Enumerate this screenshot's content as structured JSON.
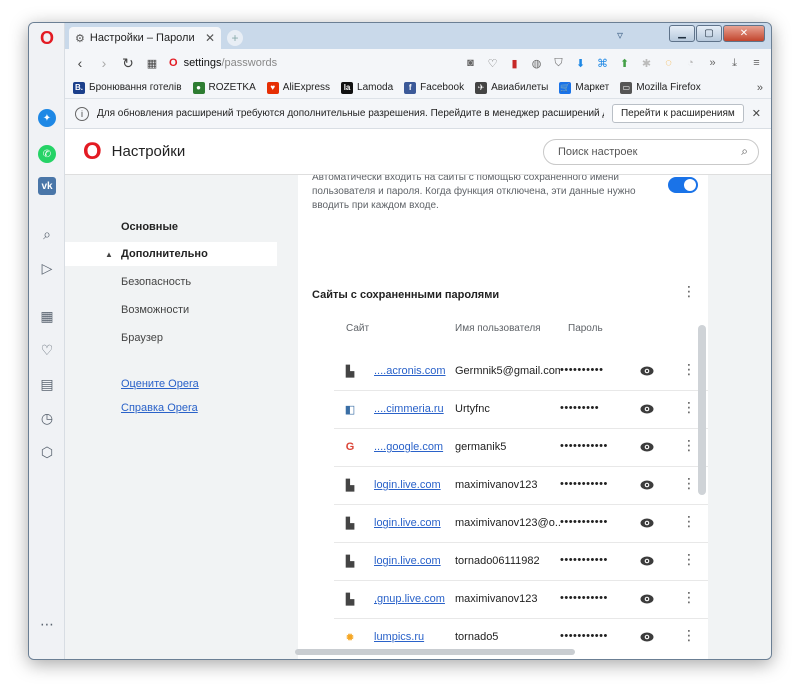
{
  "tab": {
    "title": "Настройки – Пароли"
  },
  "address": {
    "host": "settings",
    "path": "/passwords"
  },
  "bookmarks": [
    {
      "label": "Бронювання готелів",
      "icon": "booking-icon",
      "color": "#1b3f8b",
      "glyph": "B."
    },
    {
      "label": "ROZETKA",
      "icon": "rozetka-icon",
      "color": "#2e7d32",
      "glyph": "●"
    },
    {
      "label": "AliExpress",
      "icon": "aliexpress-icon",
      "color": "#e62e04",
      "glyph": "♥"
    },
    {
      "label": "Lamoda",
      "icon": "lamoda-icon",
      "color": "#111111",
      "glyph": "la"
    },
    {
      "label": "Facebook",
      "icon": "facebook-icon",
      "color": "#3b5998",
      "glyph": "f"
    },
    {
      "label": "Авиабилеты",
      "icon": "plane-icon",
      "color": "#444444",
      "glyph": "✈"
    },
    {
      "label": "Маркет",
      "icon": "cart-icon",
      "color": "#1a73e8",
      "glyph": "🛒"
    },
    {
      "label": "Mozilla Firefox",
      "icon": "folder-icon",
      "color": "#555555",
      "glyph": "▭"
    }
  ],
  "notification": {
    "text": "Для обновления расширений требуются дополнительные разрешения. Перейдите в менеджер расширений дл...",
    "button": "Перейти к расширениям"
  },
  "header": {
    "title": "Настройки",
    "search_placeholder": "Поиск настроек"
  },
  "nav": {
    "basic": "Основные",
    "advanced": "Дополнительно",
    "security": "Безопасность",
    "features": "Возможности",
    "browser": "Браузер",
    "rate": "Оцените Opera",
    "help": "Справка Opera"
  },
  "passwords": {
    "autologin_text": "Автоматически входить на сайты с помощью сохраненного имени пользователя и пароля. Когда функция отключена, эти данные нужно вводить при каждом входе.",
    "autologin_enabled": true,
    "section_title": "Сайты с сохраненными паролями",
    "columns": {
      "site": "Сайт",
      "user": "Имя пользователя",
      "password": "Пароль"
    },
    "rows": [
      {
        "site": "....acronis.com",
        "user": "Germnik5@gmail.com",
        "password": "••••••••••",
        "icon": "file-icon"
      },
      {
        "site": "....cimmeria.ru",
        "user": "Urtyfnc",
        "password": "•••••••••",
        "icon": "cimmeria-icon"
      },
      {
        "site": "....google.com",
        "user": "germanik5",
        "password": "•••••••••••",
        "icon": "google-icon"
      },
      {
        "site": "login.live.com",
        "user": "maximivanov123",
        "password": "•••••••••••",
        "icon": "file-icon"
      },
      {
        "site": "login.live.com",
        "user": "maximivanov123@o...",
        "password": "•••••••••••",
        "icon": "file-icon"
      },
      {
        "site": "login.live.com",
        "user": "tornado06111982",
        "password": "•••••••••••",
        "icon": "file-icon"
      },
      {
        "site": ",gnup.live.com",
        "user": "maximivanov123",
        "password": "•••••••••••",
        "icon": "file-icon"
      },
      {
        "site": "lumpics.ru",
        "user": "tornado5",
        "password": "•••••••••••",
        "icon": "lumpics-icon"
      }
    ]
  }
}
